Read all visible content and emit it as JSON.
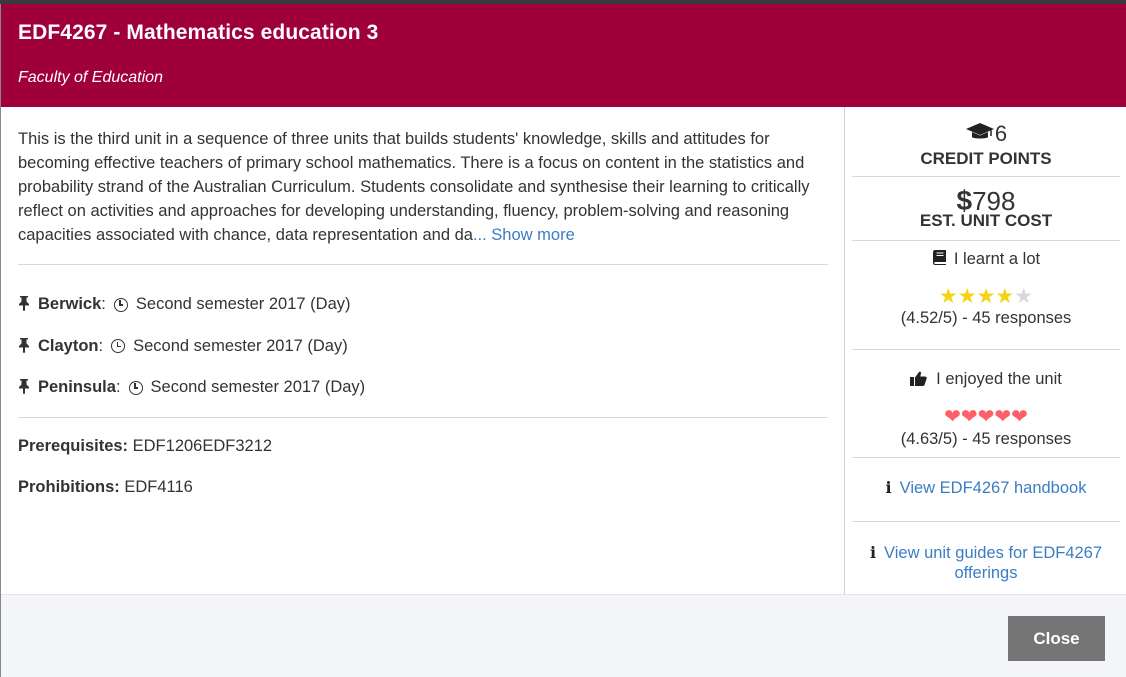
{
  "header": {
    "title": "EDF4267 - Mathematics education 3",
    "faculty": "Faculty of Education"
  },
  "description": {
    "text": "This is the third unit in a sequence of three units that builds students' knowledge, skills and attitudes for becoming effective teachers of primary school mathematics. There is a focus on content in the statistics and probability strand of the Australian Curriculum. Students consolidate and synthesise their learning to critically reflect on activities and approaches for developing understanding, fluency, problem-solving and reasoning capacities associated with chance, data representation and da",
    "show_more": "... Show more"
  },
  "locations": [
    {
      "campus": "Berwick",
      "offering": "Second semester 2017 (Day)"
    },
    {
      "campus": "Clayton",
      "offering": "Second semester 2017 (Day)"
    },
    {
      "campus": "Peninsula",
      "offering": "Second semester 2017 (Day)"
    }
  ],
  "requisites": {
    "prerequisites_label": "Prerequisites:",
    "prerequisites_value": "EDF1206EDF3212",
    "prohibitions_label": "Prohibitions:",
    "prohibitions_value": "EDF4116"
  },
  "sidebar": {
    "credit_points_value": "6",
    "credit_points_label": "CREDIT POINTS",
    "cost_symbol": "$",
    "cost_value": "798",
    "cost_label": "EST. UNIT COST",
    "learnt_label": "I learnt a lot",
    "learnt_rating": 4.52,
    "learnt_stars_filled": 4,
    "learnt_stars_total": 5,
    "learnt_score": "(4.52/5) - 45 responses",
    "enjoyed_label": "I enjoyed the unit",
    "enjoyed_rating": 4.63,
    "enjoyed_hearts": 5,
    "enjoyed_score": "(4.63/5) - 45 responses",
    "handbook_link": "View EDF4267 handbook",
    "guides_link": "View unit guides for EDF4267 offerings"
  },
  "footer": {
    "close_label": "Close"
  },
  "colors": {
    "header_bg": "#a0003a",
    "link": "#3a7dc4",
    "star": "#f4d312",
    "heart": "#ff5f68",
    "close_button_bg": "#757575"
  },
  "icons": {
    "location": "thumbtack-icon",
    "time": "clock-icon",
    "credit": "graduation-cap-icon",
    "learnt": "book-icon",
    "enjoyed": "thumbs-up-icon",
    "info": "info-icon",
    "rating": "star-icon",
    "enjoy_rating": "heart-icon"
  }
}
